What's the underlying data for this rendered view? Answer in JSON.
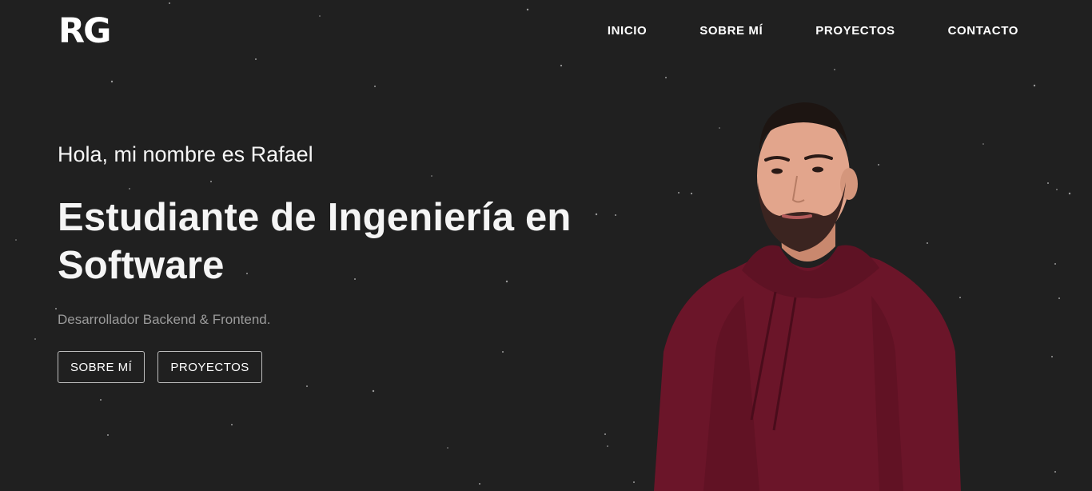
{
  "header": {
    "logo": "RG",
    "nav": [
      {
        "label": "INICIO"
      },
      {
        "label": "SOBRE MÍ"
      },
      {
        "label": "PROYECTOS"
      },
      {
        "label": "CONTACTO"
      }
    ]
  },
  "hero": {
    "greeting": "Hola, mi nombre es Rafael",
    "headline_line1": "Estudiante de Ingeniería en",
    "headline_line2": "Software",
    "tagline": "Desarrollador Backend & Frontend.",
    "buttons": [
      {
        "label": "SOBRE MÍ"
      },
      {
        "label": "PROYECTOS"
      }
    ]
  },
  "colors": {
    "background": "#202020",
    "text": "#f5f5f5",
    "muted_text": "#9b9b9b",
    "hoodie": "#6b1529"
  }
}
